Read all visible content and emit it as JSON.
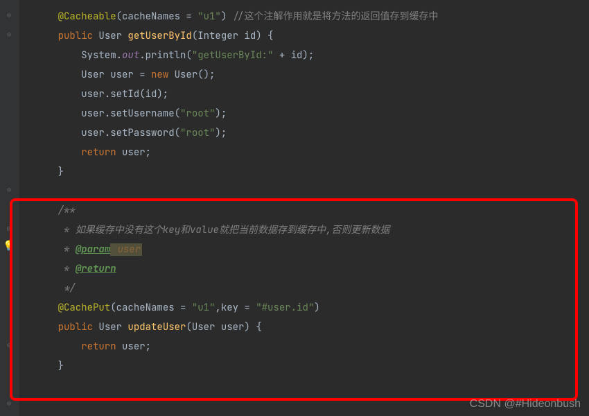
{
  "code": {
    "l1_annotation": "@Cacheable",
    "l1_paren_open": "(",
    "l1_attr": "cacheNames = ",
    "l1_value": "\"u1\"",
    "l1_paren_close": ") ",
    "l1_comment": "//这个注解作用就是将方法的返回值存到缓存中",
    "l2_public": "public ",
    "l2_type": "User ",
    "l2_method": "getUserById",
    "l2_params": "(Integer id) {",
    "l3_prefix": "System.",
    "l3_out": "out",
    "l3_println": ".println(",
    "l3_str": "\"getUserById:\"",
    "l3_suffix": " + id);",
    "l4_prefix": "User user = ",
    "l4_new": "new ",
    "l4_suffix": "User();",
    "l5": "user.setId(id);",
    "l6_prefix": "user.setUsername(",
    "l6_str": "\"root\"",
    "l6_suffix": ");",
    "l7_prefix": "user.setPassword(",
    "l7_str": "\"root\"",
    "l7_suffix": ");",
    "l8_return": "return ",
    "l8_suffix": "user;",
    "l9": "}",
    "doc_start": "/**",
    "doc_line1": " * 如果缓存中没有这个key和value就把当前数据存到缓存中,否则更新数据",
    "doc_line2_prefix": " * ",
    "doc_param_tag": "@param",
    "doc_param_name": " user",
    "doc_line3_prefix": " * ",
    "doc_return_tag": "@return",
    "doc_end": " */",
    "cp_annotation": "@CachePut",
    "cp_paren_open": "(",
    "cp_attr1": "cacheNames = ",
    "cp_val1": "\"u1\"",
    "cp_comma": ",key = ",
    "cp_val2": "\"#user.id\"",
    "cp_paren_close": ")",
    "up_public": "public ",
    "up_type": "User ",
    "up_method": "updateUser",
    "up_params": "(User user) {",
    "up_return": "return ",
    "up_suffix": "user;",
    "up_close": "}"
  },
  "watermark": "CSDN @#Hideonbush"
}
